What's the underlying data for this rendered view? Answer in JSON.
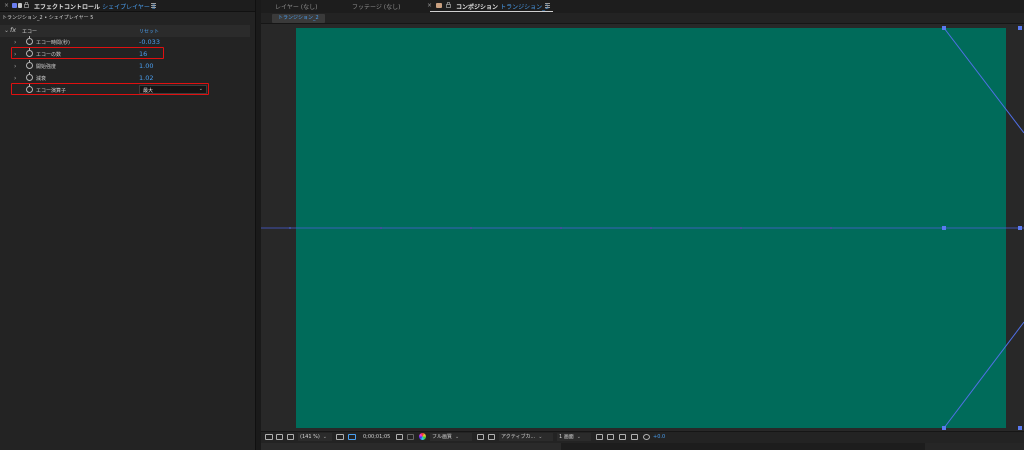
{
  "left_panel": {
    "tab": {
      "title": "エフェクトコントロール",
      "layer": "シェイプレイヤー 5",
      "colors": {
        "square1": "#6b7ef0",
        "square2": "#c8c8c8"
      }
    },
    "subtitle": "トランジション_2 • シェイプレイヤー 5",
    "effect": {
      "fx": "fx",
      "name": "エコー",
      "reset": "リセット"
    },
    "properties": [
      {
        "label": "エコー時間(秒)",
        "value": "-0.033",
        "has_caret": true,
        "highlighted": false
      },
      {
        "label": "エコーの数",
        "value": "16",
        "has_caret": true,
        "highlighted": true
      },
      {
        "label": "開始強度",
        "value": "1.00",
        "has_caret": true,
        "highlighted": false
      },
      {
        "label": "減衰",
        "value": "1.02",
        "has_caret": true,
        "highlighted": false
      }
    ],
    "operator": {
      "label": "エコー演算子",
      "value": "最大",
      "highlighted": true
    }
  },
  "right_panel": {
    "tabs": {
      "layer": "レイヤー (なし)",
      "footage": "フッテージ (なし)"
    },
    "comp_tab": {
      "prefix": "コンポジション",
      "name": "トランジション_2"
    },
    "comp_chip": "トランジション_2",
    "canvas_color": "#006b5a",
    "bottom": {
      "zoom": "(141 %)",
      "timecode": "0;00;01;05",
      "resolution": "フル画質",
      "camera": "アクティブカ...",
      "views": "1 画面",
      "exposure": "+0.0"
    }
  },
  "accent": "#4a9ff0",
  "highlight_color": "#e01010"
}
